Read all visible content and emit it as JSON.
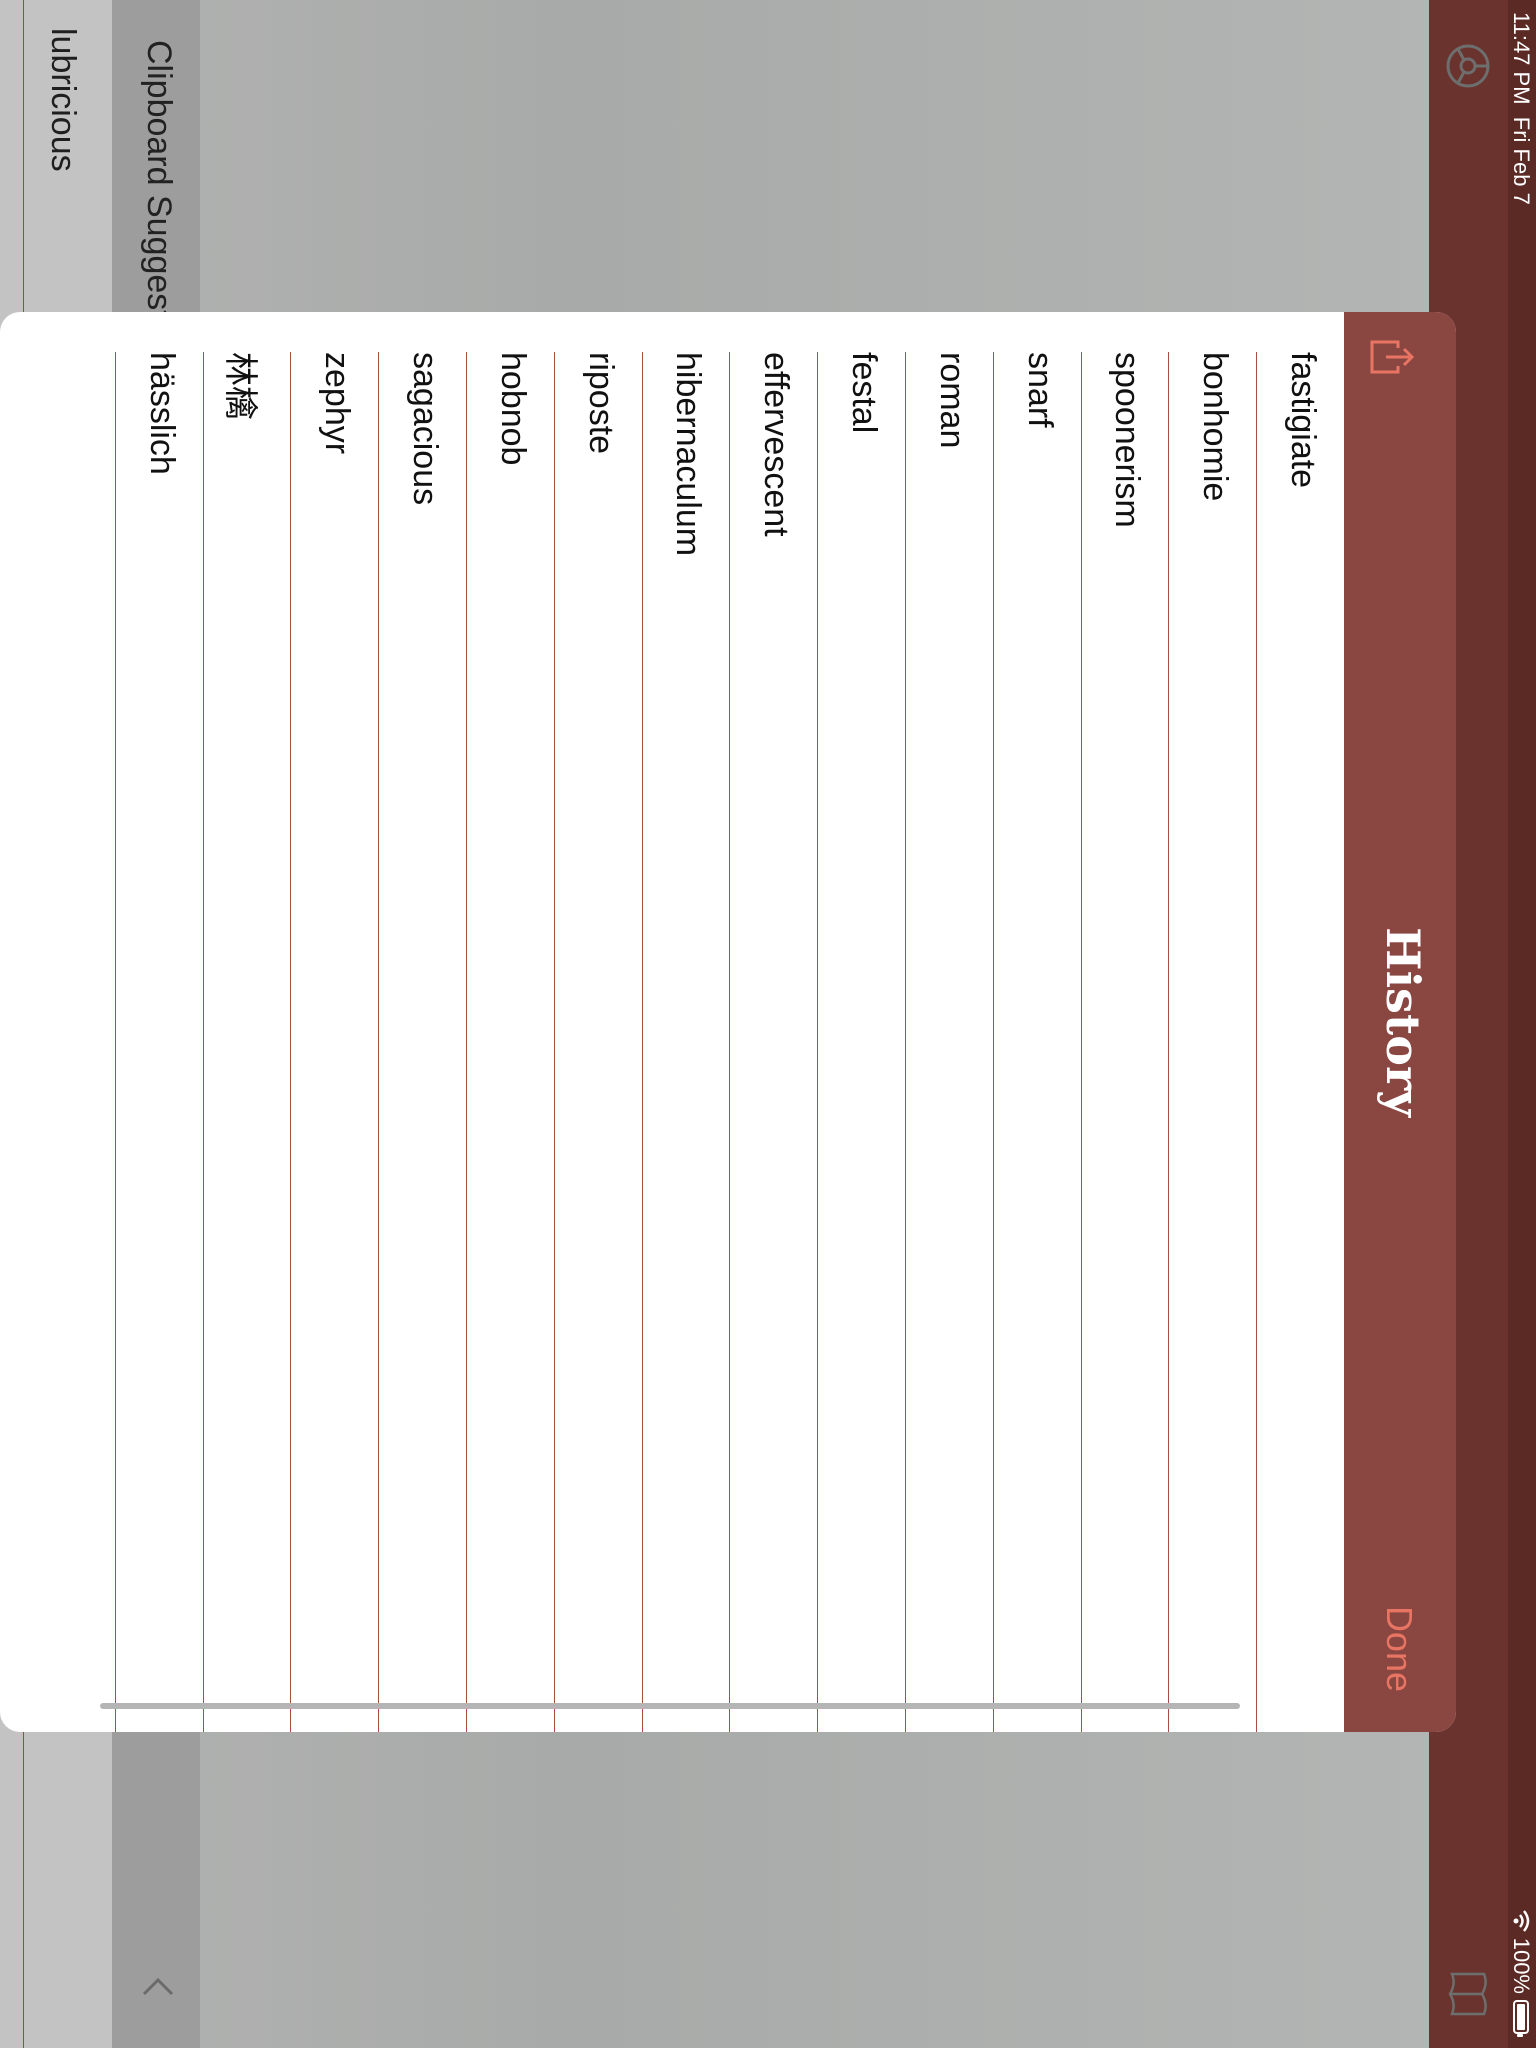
{
  "status_bar": {
    "time": "11:47 PM",
    "date": "Fri Feb 7",
    "battery": "100%"
  },
  "modal": {
    "title": "History",
    "done_label": "Done",
    "items": [
      "fastigiate",
      "bonhomie",
      "spoonerism",
      "snarf",
      "roman",
      "festal",
      "effervescent",
      "hibernaculum",
      "riposte",
      "hobnob",
      "sagacious",
      "zephyr",
      "林檎",
      "hässlich"
    ]
  },
  "background": {
    "section_header": "Clipboard Suggestions",
    "suggestion": "lubricious"
  },
  "icons": {
    "settings": "gear-icon",
    "share": "share-icon",
    "book": "book-icon",
    "back": "chevron-left-icon"
  },
  "colors": {
    "nav": "#6a332e",
    "modal_header": "#8a4641",
    "accent": "#e87563",
    "separator": "#a84e44"
  }
}
